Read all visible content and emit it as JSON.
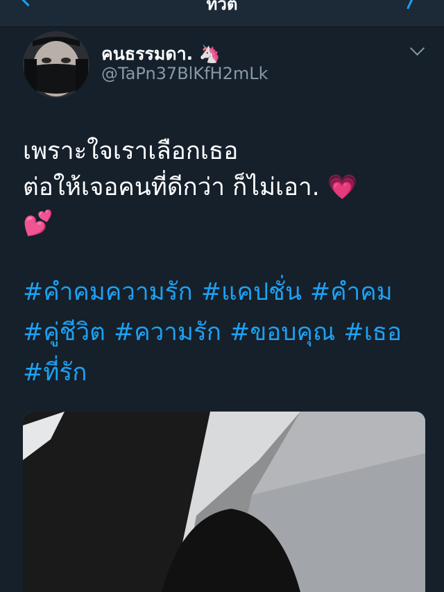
{
  "header": {
    "title": "ทวีต",
    "back_icon": "chevron-left-icon",
    "right_icon": "chevron-right-icon"
  },
  "tweet": {
    "author": {
      "name": "คนธรรมดา.",
      "name_emoji": "🦄",
      "handle": "@TaPn37BlKfH2mLk"
    },
    "menu_icon": "chevron-down-icon",
    "text_lines": [
      "เพราะใจเราเลือกเธอ",
      "ต่อให้เจอคนที่ดีกว่า ก็ไม่เอา. 💗",
      "💕"
    ],
    "hashtag_lines": [
      [
        "#คำคมความรัก",
        "#แคปชั่น",
        "#คำคม"
      ],
      [
        "#คู่ชีวิต",
        "#ความรัก",
        "#ขอบคุณ",
        "#เธอ"
      ],
      [
        "#ที่รัก"
      ]
    ]
  },
  "colors": {
    "background": "#15202b",
    "header_background": "#1c2a38",
    "accent": "#1da1f2",
    "secondary_text": "#8899a6"
  }
}
